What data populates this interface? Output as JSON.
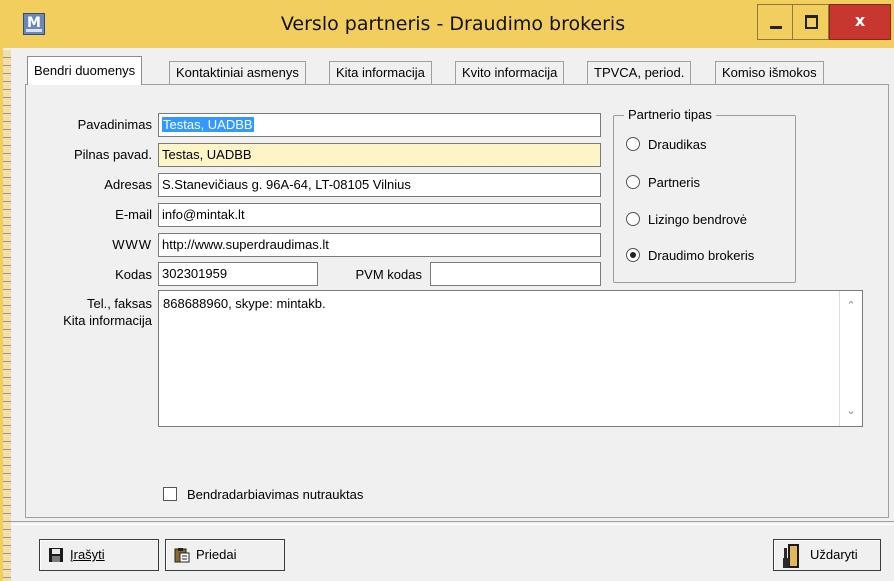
{
  "window": {
    "title": "Verslo partneris - Draudimo brokeris",
    "app_icon_letter": "M",
    "close_glyph": "x",
    "accent_color": "#f2ce5e"
  },
  "tabs": [
    {
      "label": "Bendri duomenys"
    },
    {
      "label": "Kontaktiniai asmenys"
    },
    {
      "label": "Kita informacija"
    },
    {
      "label": "Kvito informacija"
    },
    {
      "label": "TPVCA, period."
    },
    {
      "label": "Komiso išmokos"
    }
  ],
  "form": {
    "pavadinimas": {
      "label": "Pavadinimas",
      "value": "Testas, UADBB"
    },
    "pilnas": {
      "label": "Pilnas pavad.",
      "value": "Testas, UADBB"
    },
    "adresas": {
      "label": "Adresas",
      "value": "S.Stanevičiaus g. 96A-64, LT-08105 Vilnius"
    },
    "email": {
      "label": "E-mail",
      "value": "info@mintak.lt"
    },
    "www": {
      "label": "WWW",
      "value": "http://www.superdraudimas.lt"
    },
    "kodas": {
      "label": "Kodas",
      "value": "302301959"
    },
    "pvm": {
      "label": "PVM kodas",
      "value": ""
    },
    "tel_label": "Tel., faksas",
    "kita_label": "Kita informacija",
    "memo_value": "868688960, skype: mintakb."
  },
  "partner_type": {
    "legend": "Partnerio tipas",
    "options": [
      {
        "label": "Draudikas",
        "selected": false
      },
      {
        "label": "Partneris",
        "selected": false
      },
      {
        "label": "Lizingo bendrovė",
        "selected": false
      },
      {
        "label": "Draudimo brokeris",
        "selected": true
      }
    ]
  },
  "checkbox": {
    "label": "Bendradarbiavimas nutrauktas",
    "checked": false
  },
  "buttons": {
    "save": {
      "label": "Įrašyti",
      "icon": "floppy-disk-icon"
    },
    "attachments": {
      "label": "Priedai",
      "icon": "clipboard-icon"
    },
    "close": {
      "label": "Uždaryti",
      "icon": "exit-door-icon"
    }
  }
}
